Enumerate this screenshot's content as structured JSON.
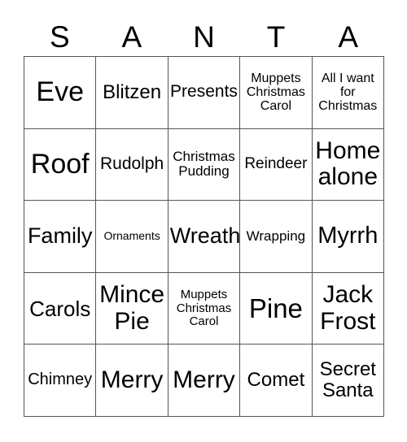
{
  "card": {
    "header_letters": [
      "S",
      "A",
      "N",
      "T",
      "A"
    ],
    "border_color": "#555555",
    "text_color": "#000000",
    "background_color": "#ffffff",
    "rows": 5,
    "columns": 5,
    "cells": [
      {
        "text": "Eve",
        "font_size": "34px"
      },
      {
        "text": "Blitzen",
        "font_size": "24px"
      },
      {
        "text": "Presents",
        "font_size": "21px"
      },
      {
        "text": "Muppets\nChristmas\nCarol",
        "font_size": "16px"
      },
      {
        "text": "All I want\nfor\nChristmas",
        "font_size": "16px"
      },
      {
        "text": "Roof",
        "font_size": "34px"
      },
      {
        "text": "Rudolph",
        "font_size": "21px"
      },
      {
        "text": "Christmas\nPudding",
        "font_size": "17px"
      },
      {
        "text": "Reindeer",
        "font_size": "19px"
      },
      {
        "text": "Home\nalone",
        "font_size": "30px"
      },
      {
        "text": "Family",
        "font_size": "27px"
      },
      {
        "text": "Ornaments",
        "font_size": "14px"
      },
      {
        "text": "Wreath",
        "font_size": "27px"
      },
      {
        "text": "Wrapping",
        "font_size": "17px"
      },
      {
        "text": "Myrrh",
        "font_size": "29px"
      },
      {
        "text": "Carols",
        "font_size": "26px"
      },
      {
        "text": "Mince\nPie",
        "font_size": "30px"
      },
      {
        "text": "Muppets\nChristmas\nCarol",
        "font_size": "15px"
      },
      {
        "text": "Pine",
        "font_size": "33px"
      },
      {
        "text": "Jack\nFrost",
        "font_size": "30px"
      },
      {
        "text": "Chimney",
        "font_size": "20px"
      },
      {
        "text": "Merry",
        "font_size": "30px"
      },
      {
        "text": "Merry",
        "font_size": "30px"
      },
      {
        "text": "Comet",
        "font_size": "24px"
      },
      {
        "text": "Secret\nSanta",
        "font_size": "24px"
      }
    ]
  }
}
